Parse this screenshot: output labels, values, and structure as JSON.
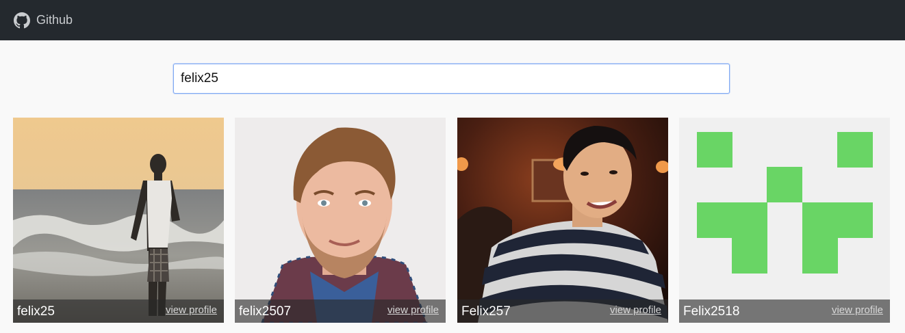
{
  "navbar": {
    "brand_label": "Github",
    "brand_icon": "github-icon"
  },
  "search": {
    "value": "felix25",
    "placeholder": ""
  },
  "results": [
    {
      "login": "felix25",
      "link_label": "view profile",
      "avatar": "photo-beach"
    },
    {
      "login": "felix2507",
      "link_label": "view profile",
      "avatar": "photo-portrait"
    },
    {
      "login": "Felix257",
      "link_label": "view profile",
      "avatar": "photo-restaurant"
    },
    {
      "login": "Felix2518",
      "link_label": "view profile",
      "avatar": "identicon",
      "identicon_color": "#69d565"
    }
  ],
  "colors": {
    "navbar_bg": "#24292e",
    "page_bg": "#f9f9f9",
    "input_focus_border": "#80a9f3",
    "identicon_green": "#69d565"
  }
}
